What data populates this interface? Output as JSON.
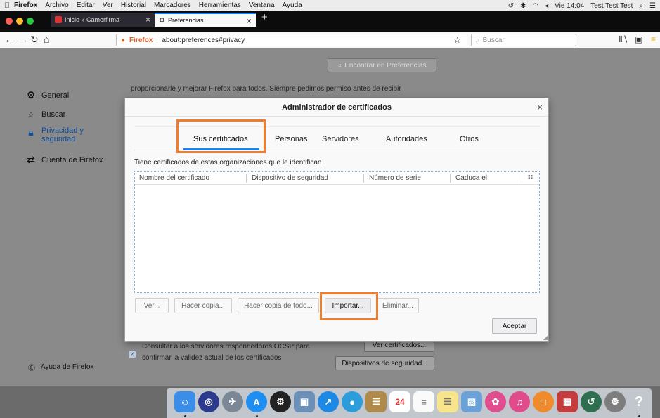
{
  "menubar": {
    "apple": "",
    "items": [
      "Firefox",
      "Archivo",
      "Editar",
      "Ver",
      "Historial",
      "Marcadores",
      "Herramientas",
      "Ventana",
      "Ayuda"
    ],
    "clock": "Vie 14:04",
    "user": "Test Test Test"
  },
  "tabs": [
    {
      "label": "Inicio » Camerfirma"
    },
    {
      "label": "Preferencias"
    }
  ],
  "navbar": {
    "brand": "Firefox",
    "url": "about:preferences#privacy",
    "search_placeholder": "Buscar"
  },
  "prefs": {
    "search_placeholder": "Encontrar en Preferencias",
    "sidebar": [
      {
        "label": "General",
        "icon": "gear-icon"
      },
      {
        "label": "Buscar",
        "icon": "search-icon"
      },
      {
        "label": "Privacidad y seguridad",
        "icon": "lock-icon"
      },
      {
        "label": "Cuenta de Firefox",
        "icon": "sync-icon"
      }
    ],
    "bg_text": "proporcionarle y mejorar Firefox para todos. Siempre pedimos permiso antes de recibir",
    "ocsp_line1": "Consultar a los servidores respondedores OCSP para",
    "ocsp_line2": "confirmar la validez actual de los certificados",
    "view_certs": "Ver certificados...",
    "security_devices": "Dispositivos de seguridad...",
    "help": "Ayuda de Firefox"
  },
  "dialog": {
    "title": "Administrador de certificados",
    "tabs": [
      "Sus certificados",
      "Personas",
      "Servidores",
      "Autoridades",
      "Otros"
    ],
    "hint": "Tiene certificados de estas organizaciones que le identifican",
    "columns": [
      "Nombre del certificado",
      "Dispositivo de seguridad",
      "Número de serie",
      "Caduca el"
    ],
    "buttons": {
      "view": "Ver...",
      "backup": "Hacer copia...",
      "backup_all": "Hacer copia de todo...",
      "import": "Importar...",
      "delete": "Eliminar..."
    },
    "accept": "Aceptar"
  },
  "colors": {
    "highlight": "#ef7d2e",
    "accent": "#0a84ff",
    "firefox_brand": "#e25920"
  }
}
